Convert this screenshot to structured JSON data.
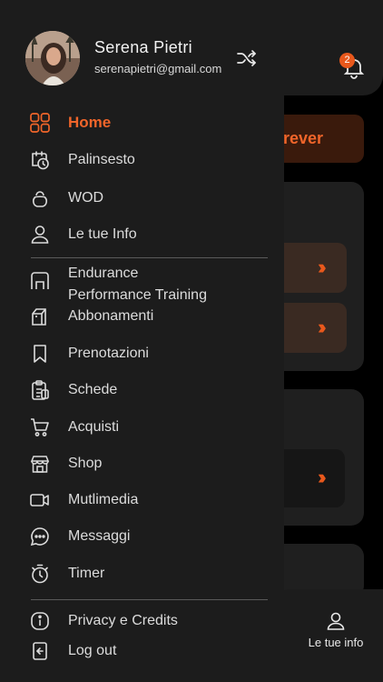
{
  "user": {
    "name": "Serena Pietri",
    "email": "serenapietri@gmail.com"
  },
  "notifications": {
    "count": "2"
  },
  "background": {
    "banner_fragment": "rever",
    "bottom_tab_label": "Le tue info"
  },
  "menu": {
    "home": "Home",
    "palinsesto": "Palinsesto",
    "wod": "WOD",
    "info": "Le tue Info",
    "endurance_line1": "Endurance",
    "endurance_line2": "Performance Training",
    "abbonamenti": "Abbonamenti",
    "prenotazioni": "Prenotazioni",
    "schede": "Schede",
    "acquisti": "Acquisti",
    "shop": "Shop",
    "multimedia": "Mutlimedia",
    "messaggi": "Messaggi",
    "timer": "Timer",
    "privacy": "Privacy e Credits",
    "logout": "Log out"
  },
  "colors": {
    "accent": "#f0652a",
    "drawer_bg": "#1c1c1c",
    "text": "#dcdcdc"
  },
  "icons": {
    "home": "grid-icon",
    "palinsesto": "calendar-history-icon",
    "wod": "kettlebell-icon",
    "info": "user-icon",
    "endurance": "gym-icon",
    "abbonamenti": "bag-icon",
    "prenotazioni": "bookmark-icon",
    "schede": "clipboard-icon",
    "acquisti": "cart-icon",
    "shop": "store-icon",
    "multimedia": "video-icon",
    "messaggi": "chat-icon",
    "timer": "stopwatch-icon",
    "privacy": "info-icon",
    "logout": "logout-icon"
  }
}
